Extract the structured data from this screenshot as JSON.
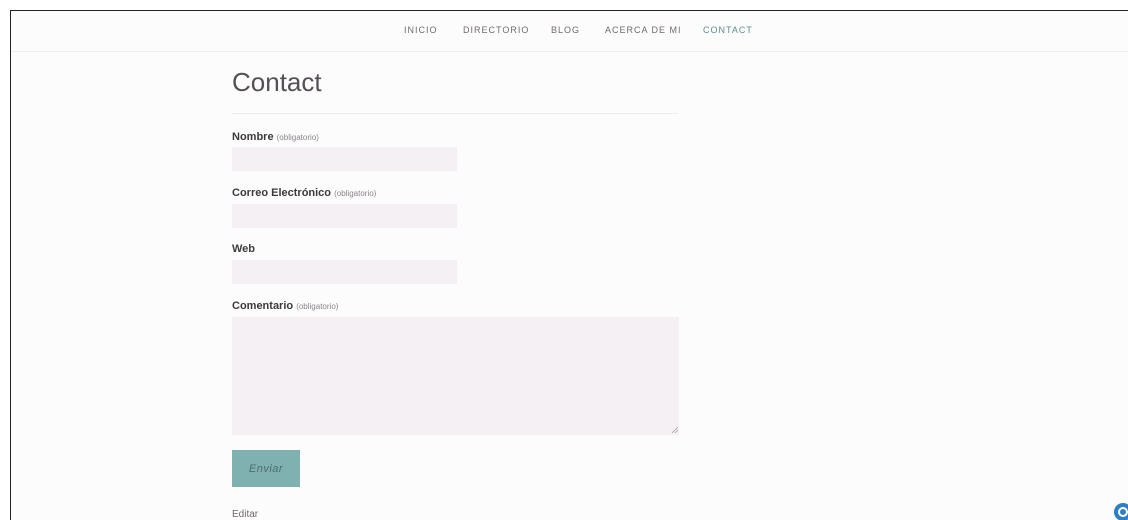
{
  "nav": {
    "items": [
      {
        "label": "INICIO"
      },
      {
        "label": "DIRECTORIO"
      },
      {
        "label": "BLOG"
      },
      {
        "label": "ACERCA DE MI"
      },
      {
        "label": "CONTACT"
      }
    ],
    "active_index": 4
  },
  "page": {
    "title": "Contact"
  },
  "form": {
    "nombre": {
      "label": "Nombre",
      "required_note": "(obligatorio)",
      "value": ""
    },
    "correo": {
      "label": "Correo Electrónico",
      "required_note": "(obligatorio)",
      "value": ""
    },
    "web": {
      "label": "Web",
      "value": ""
    },
    "comentario": {
      "label": "Comentario",
      "required_note": "(obligatorio)",
      "value": ""
    },
    "submit_label": "Enviar"
  },
  "footer": {
    "edit_label": "Editar"
  },
  "colors": {
    "accent": "#7fb1b1",
    "active_nav": "#5b8e8f",
    "field_bg": "#f4f0f4",
    "badge": "#2e7ec6"
  },
  "icons": {
    "corner_badge": "circle-badge-icon",
    "resize": "resize-handle-icon"
  }
}
